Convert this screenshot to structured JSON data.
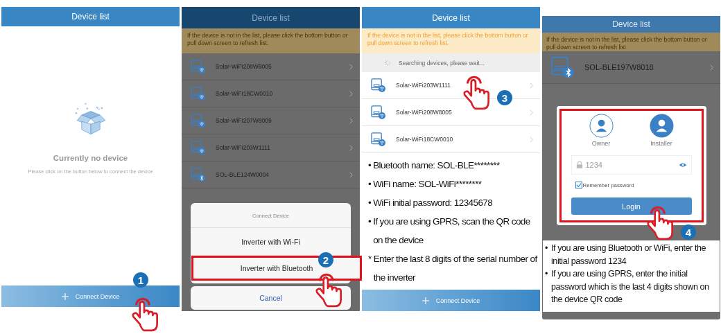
{
  "panels": [
    {
      "kind": "empty",
      "dimmed": false,
      "title": "Device list",
      "empty_title": "Currently no device",
      "empty_hint": "Please click on the button below to connect the device",
      "connect_button": "Connect Device",
      "step": "1"
    },
    {
      "kind": "sheet",
      "dimmed": true,
      "title": "Device list",
      "notice": "If the device is not in the list, please click the bottom button or pull down screen to refresh list.",
      "devices": [
        {
          "name": "Solar-WiFi208W8005",
          "kind": "wifi"
        },
        {
          "name": "Solar-WiFi18CW0010",
          "kind": "wifi"
        },
        {
          "name": "Solar-WiFi207W8009",
          "kind": "wifi"
        },
        {
          "name": "Solar-WiFi203W1111",
          "kind": "wifi"
        },
        {
          "name": "SOL-BLE124W0004",
          "kind": "bluetooth"
        }
      ],
      "sheet": {
        "title": "Connect Device",
        "options": [
          {
            "label": "Inverter with Wi-Fi",
            "selected": false
          },
          {
            "label": "Inverter with Bluetooth",
            "selected": true
          }
        ],
        "cancel": "Cancel"
      },
      "step": "2"
    },
    {
      "kind": "search",
      "dimmed": false,
      "title": "Device list",
      "notice": "If the device is not in the list, please click the bottom button or pull down screen to refresh list.",
      "searching": "Searching devices, please wait...",
      "devices": [
        {
          "name": "Solar-WiFi203W1111",
          "kind": "wifi"
        },
        {
          "name": "Solar-WiFi208W8005",
          "kind": "wifi"
        },
        {
          "name": "Solar-WiFi18CW0010",
          "kind": "wifi"
        }
      ],
      "notes": [
        {
          "marker": "•",
          "text": "Bluetooth name: SOL-BLE********"
        },
        {
          "marker": "•",
          "text": "WiFi name: SOL-WiFi********"
        },
        {
          "marker": "•",
          "text": "WiFi initial password: 12345678"
        },
        {
          "marker": "•",
          "text": "If you are using GPRS, scan the QR code on the device"
        },
        {
          "marker": "*",
          "text": "Enter the last 8 digits of the serial number of the inverter"
        }
      ],
      "connect_button": "Connect Device",
      "step": "3"
    },
    {
      "kind": "login",
      "dimmed": true,
      "title": "Device list",
      "notice": "If the device is not in the list, please click the bottom button or pull down screen to refresh list",
      "devices": [
        {
          "name": "SOL-BLE197W8018",
          "kind": "bluetooth"
        }
      ],
      "dialog": {
        "roles": [
          {
            "label": "Owner",
            "selected": false
          },
          {
            "label": "Installer",
            "selected": true
          }
        ],
        "password": "1234",
        "remember": {
          "label": "Remember password",
          "checked": true
        },
        "login": "Login"
      },
      "notes": [
        {
          "marker": "•",
          "text": "If you are using Bluetooth or WiFi, enter the initial password 1234"
        },
        {
          "marker": "•",
          "text": "If you are using GPRS, enter the initial password which is the last 4 digits shown on the device QR code"
        }
      ],
      "step": "4"
    }
  ]
}
